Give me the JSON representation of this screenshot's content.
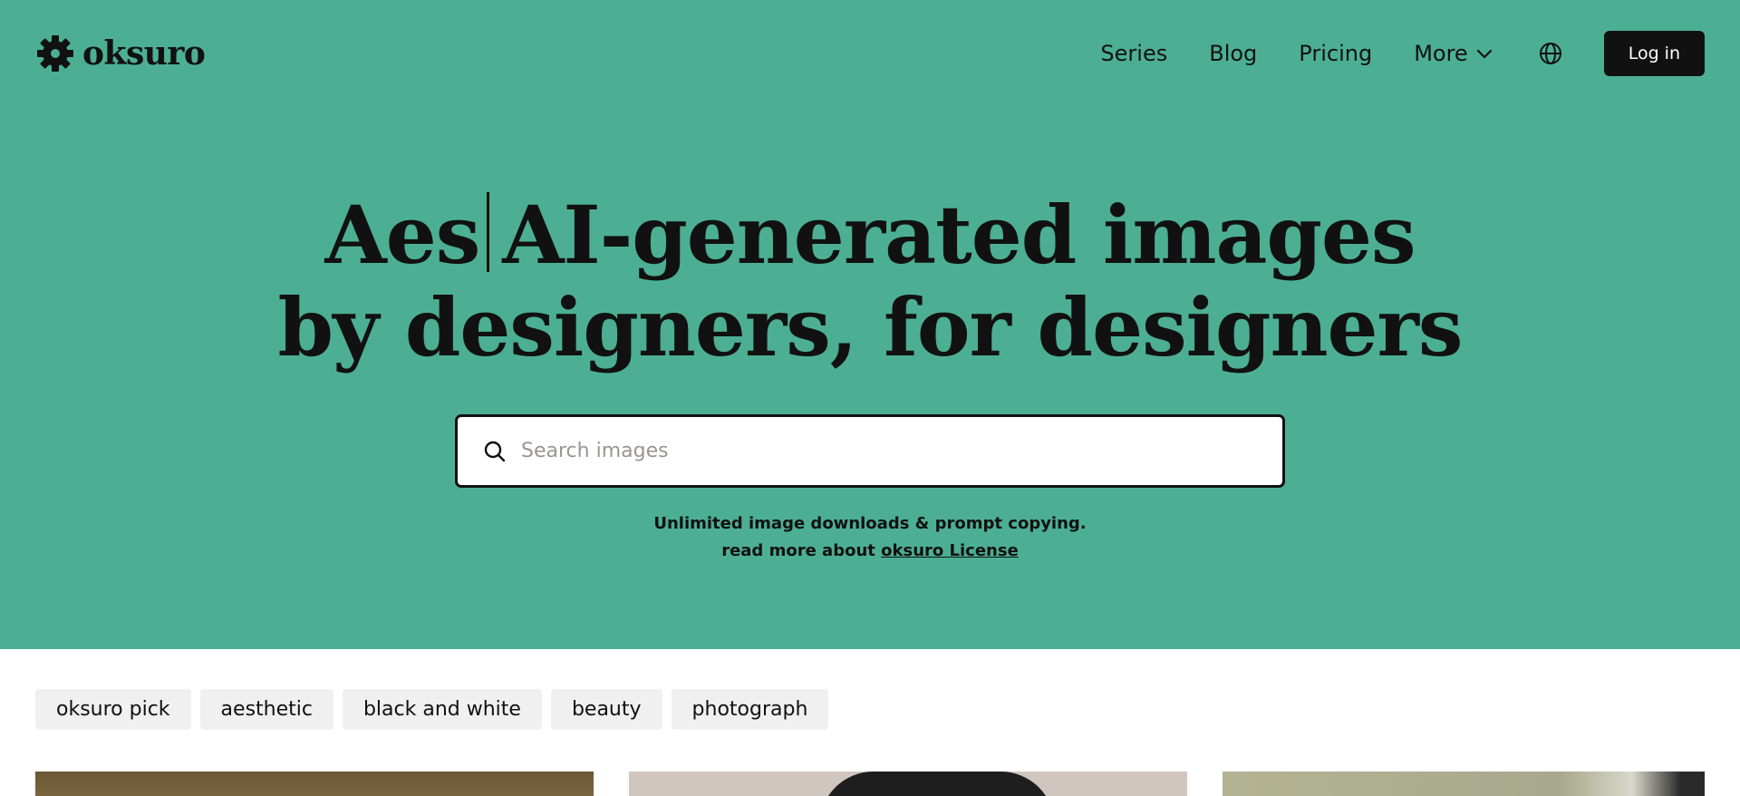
{
  "header": {
    "logo_text": "oksuro",
    "nav": {
      "series": "Series",
      "blog": "Blog",
      "pricing": "Pricing",
      "more": "More"
    },
    "login_label": "Log in"
  },
  "hero": {
    "headline_typed": "Aes",
    "headline_line1": "AI-generated images",
    "headline_line2": "by designers, for designers",
    "search_placeholder": "Search images",
    "sub_line1": "Unlimited image downloads & prompt copying.",
    "sub_line2_prefix": "read more about ",
    "sub_link": "oksuro License"
  },
  "tags": [
    "oksuro pick",
    "aesthetic",
    "black and white",
    "beauty",
    "photograph"
  ],
  "colors": {
    "hero_bg": "#4caf93",
    "text": "#111111",
    "tag_bg": "#f0f0f0",
    "button_bg": "#111111"
  },
  "icons": {
    "logo": "gear-logo-icon",
    "more": "chevron-down-icon",
    "language": "globe-icon",
    "search": "search-icon"
  }
}
